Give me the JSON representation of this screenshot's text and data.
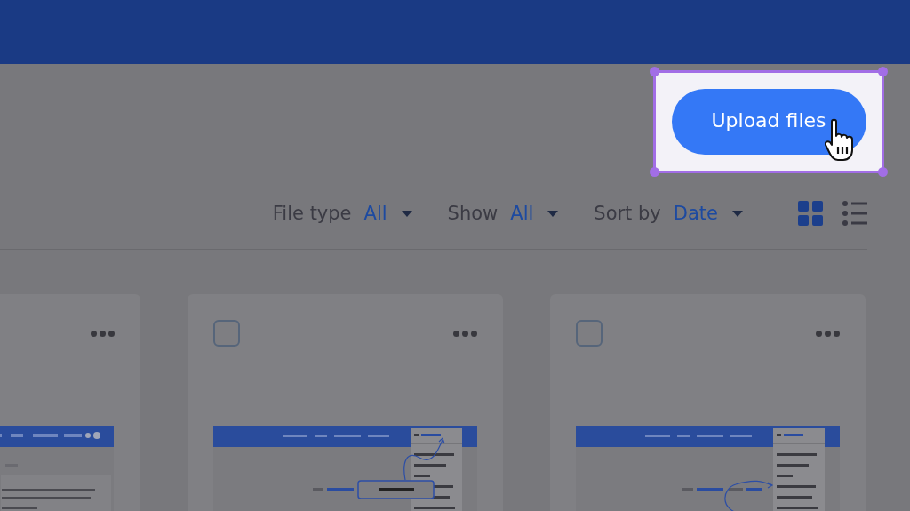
{
  "upload_button": {
    "label": "Upload files",
    "highlighted": true
  },
  "filters": [
    {
      "label": "File type",
      "value": "All"
    },
    {
      "label": "Show",
      "value": "All"
    },
    {
      "label": "Sort by",
      "value": "Date"
    }
  ],
  "view_toggle": [
    {
      "kind": "grid",
      "selected": true
    },
    {
      "kind": "list",
      "selected": false
    }
  ],
  "cards": [
    {
      "kind": "document"
    },
    {
      "kind": "callout",
      "checked": false
    },
    {
      "kind": "loop",
      "checked": false
    }
  ]
}
